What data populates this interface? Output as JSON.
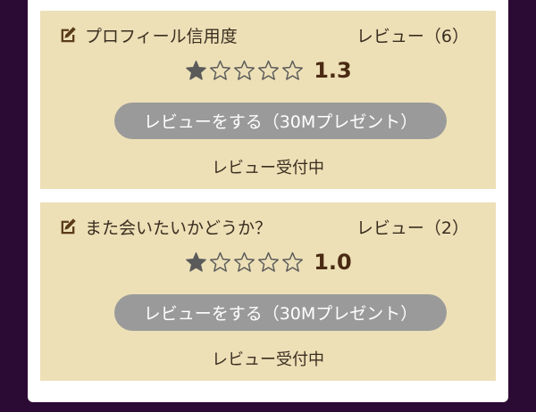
{
  "cards": [
    {
      "title": "プロフィール信用度",
      "review_count": "レビュー（6）",
      "rating": 1.3,
      "rating_text": "1.3",
      "stars_filled": 1,
      "stars_total": 5,
      "button_label": "レビューをする（30Mプレゼント）",
      "status": "レビュー受付中"
    },
    {
      "title": "また会いたいかどうか？",
      "review_count": "レビュー（2）",
      "rating": 1.0,
      "rating_text": "1.0",
      "stars_filled": 1,
      "stars_total": 5,
      "button_label": "レビューをする（30Mプレゼント）",
      "status": "レビュー受付中"
    }
  ],
  "icons": {
    "header": "edit-icon",
    "filled_star": "star-filled-icon",
    "empty_star": "star-empty-icon"
  },
  "colors": {
    "page_background": "#2b0a33",
    "panel_background": "#ffffff",
    "card_background": "#ede0b7",
    "button_background": "#9a9a9a",
    "button_text": "#ffffff",
    "rating_text": "#4a2a12",
    "star_color": "#5a5a5a"
  }
}
